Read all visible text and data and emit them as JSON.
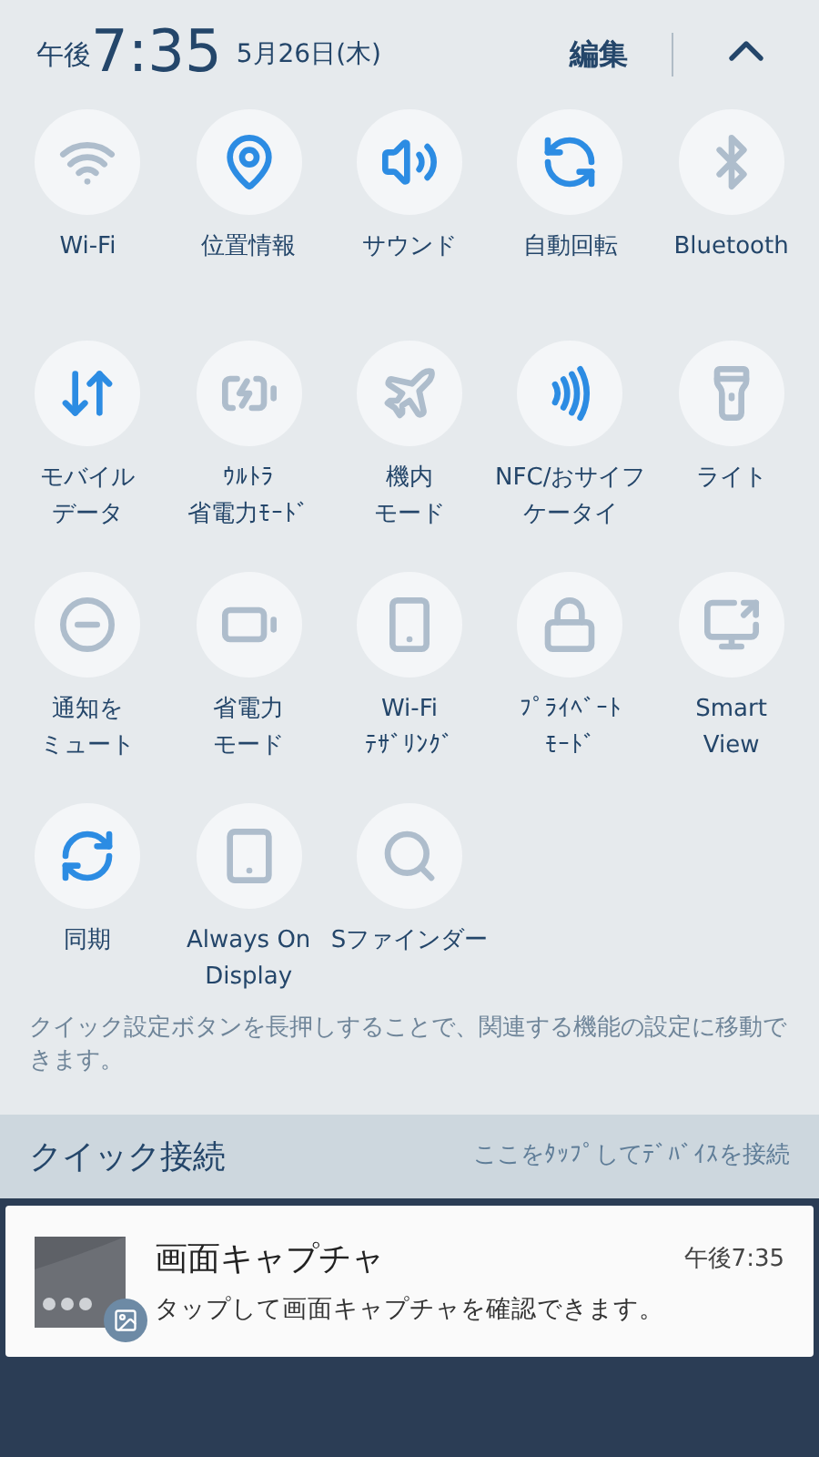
{
  "header": {
    "period": "午後",
    "time": "7:35",
    "date": "5月26日(木)",
    "edit": "編集"
  },
  "tiles": [
    {
      "kind": "wifi",
      "lines": [
        "Wi-Fi"
      ],
      "on": false
    },
    {
      "kind": "location",
      "lines": [
        "位置情報"
      ],
      "on": true
    },
    {
      "kind": "sound",
      "lines": [
        "サウンド"
      ],
      "on": true
    },
    {
      "kind": "rotate",
      "lines": [
        "自動回転"
      ],
      "on": true
    },
    {
      "kind": "bluetooth",
      "lines": [
        "Bluetooth"
      ],
      "on": false
    },
    {
      "kind": "data",
      "lines": [
        "モバイル",
        "データ"
      ],
      "on": true
    },
    {
      "kind": "ultra",
      "lines": [
        "ｳﾙﾄﾗ",
        "省電力ﾓｰﾄﾞ"
      ],
      "on": false
    },
    {
      "kind": "plane",
      "lines": [
        "機内",
        "モード"
      ],
      "on": false
    },
    {
      "kind": "nfc",
      "lines": [
        "NFC/おサイフ",
        "ケータイ"
      ],
      "on": true
    },
    {
      "kind": "light",
      "lines": [
        "ライト"
      ],
      "on": false
    },
    {
      "kind": "mute",
      "lines": [
        "通知を",
        "ミュート"
      ],
      "on": false
    },
    {
      "kind": "battery",
      "lines": [
        "省電力",
        "モード"
      ],
      "on": false
    },
    {
      "kind": "tether",
      "lines": [
        "Wi-Fi",
        "ﾃｻﾞﾘﾝｸﾞ"
      ],
      "on": false
    },
    {
      "kind": "private",
      "lines": [
        "ﾌﾟﾗｲﾍﾞｰﾄ",
        "ﾓｰﾄﾞ"
      ],
      "on": false
    },
    {
      "kind": "smartview",
      "lines": [
        "Smart",
        "View"
      ],
      "on": false
    },
    {
      "kind": "sync",
      "lines": [
        "同期"
      ],
      "on": true
    },
    {
      "kind": "aod",
      "lines": [
        "Always On",
        "Display"
      ],
      "on": false
    },
    {
      "kind": "finder",
      "lines": [
        "Sファインダー"
      ],
      "on": false
    }
  ],
  "hint": "クイック設定ボタンを長押しすることで、関連する機能の設定に移動できます。",
  "quick_connect": {
    "title": "クイック接続",
    "action": "ここをﾀｯﾌﾟしてﾃﾞﾊﾞｲｽを接続"
  },
  "notification": {
    "title": "画面キャプチャ",
    "time": "午後7:35",
    "text": "タップして画面キャプチャを確認できます。"
  }
}
